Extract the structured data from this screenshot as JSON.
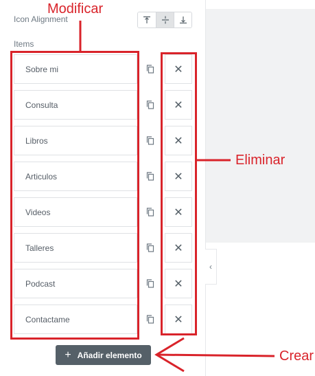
{
  "settings": {
    "icon_alignment_label": "Icon Alignment",
    "items_label": "Items",
    "alignment_options": [
      "top",
      "middle",
      "bottom"
    ],
    "alignment_selected": "middle"
  },
  "items": [
    {
      "label": "Sobre mi"
    },
    {
      "label": "Consulta"
    },
    {
      "label": "Libros"
    },
    {
      "label": "Articulos"
    },
    {
      "label": "Videos"
    },
    {
      "label": "Talleres"
    },
    {
      "label": "Podcast"
    },
    {
      "label": "Contactame"
    }
  ],
  "add_button": {
    "label": "Añadir elemento"
  },
  "annotations": {
    "modify": "Modificar",
    "delete": "Eliminar",
    "create": "Crear",
    "color": "#d9232a"
  },
  "icons": {
    "duplicate": "copy-icon",
    "delete": "close-icon",
    "add": "plus-icon",
    "collapse": "chevron-left-icon"
  }
}
